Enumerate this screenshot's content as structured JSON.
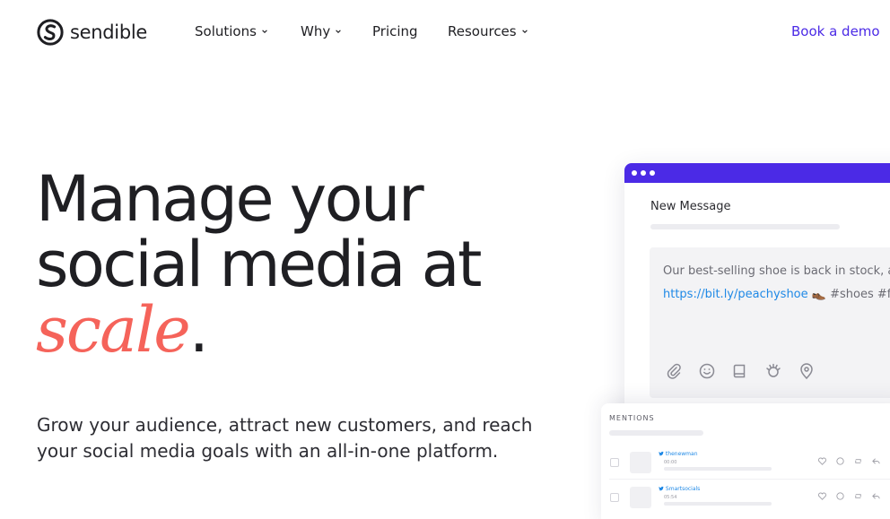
{
  "nav": {
    "logo_text": "sendible",
    "items": [
      {
        "label": "Solutions",
        "has_dropdown": true
      },
      {
        "label": "Why",
        "has_dropdown": true
      },
      {
        "label": "Pricing",
        "has_dropdown": false
      },
      {
        "label": "Resources",
        "has_dropdown": true
      }
    ],
    "cta": "Book a demo"
  },
  "hero": {
    "line1": "Manage your",
    "line2": "social media at",
    "accent": "scale",
    "period": ".",
    "subtitle": "Grow your audience, attract new customers, and reach your social media goals with an all-in-one platform."
  },
  "composer": {
    "title": "New Message",
    "text": "Our best-selling shoe is back in stock, ava",
    "link": "https://bit.ly/peachyshoe",
    "emoji": "👞",
    "hashtags": " #shoes #fas",
    "icons": [
      "attachment-icon",
      "emoji-icon",
      "book-icon",
      "badge-icon",
      "location-icon"
    ]
  },
  "mentions": {
    "label": "MENTIONS",
    "rows": [
      {
        "name": "thenewman",
        "time": "00:00"
      },
      {
        "name": "Smartsocials",
        "time": "05:54"
      }
    ]
  },
  "colors": {
    "brand": "#4b2ae6",
    "accent": "#f5635a",
    "link": "#1f89e6",
    "text": "#1f1f23"
  }
}
